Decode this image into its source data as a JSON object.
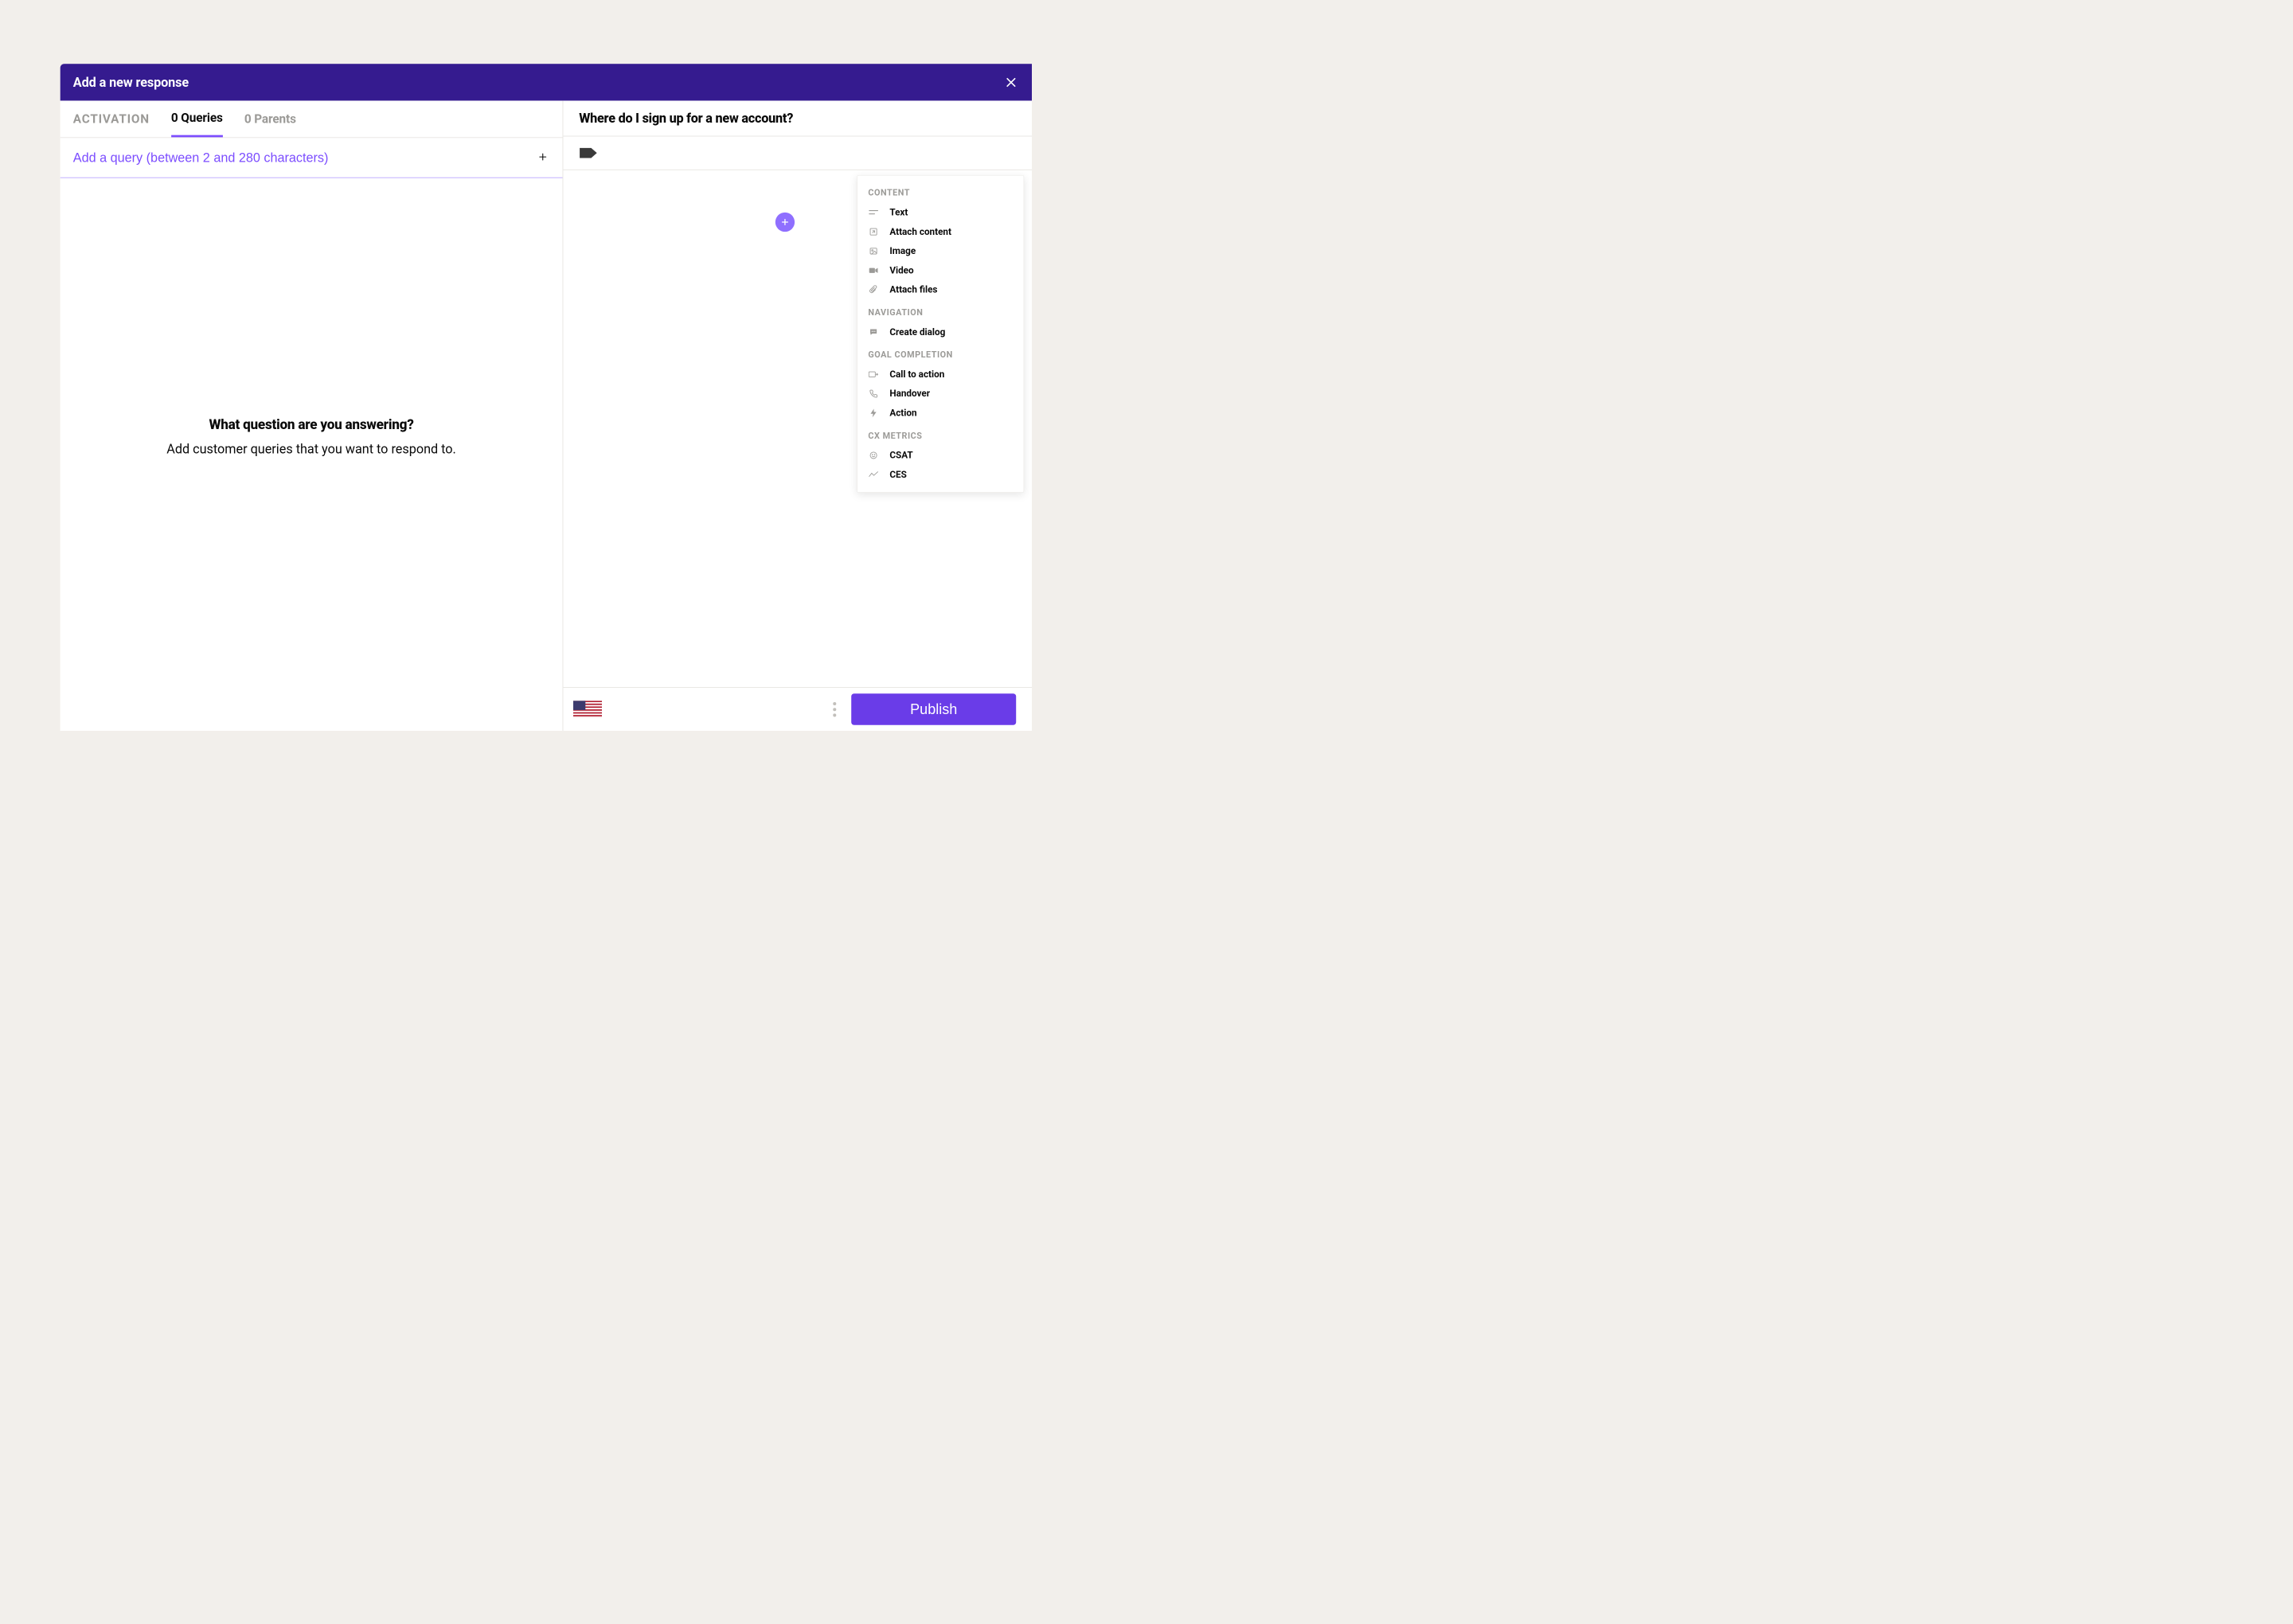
{
  "modal": {
    "title": "Add a new response"
  },
  "tabs": {
    "activation": "ACTIVATION",
    "queries": "0 Queries",
    "parents": "0 Parents"
  },
  "queryInput": {
    "placeholder": "Add a query (between 2 and 280 characters)"
  },
  "leftEmpty": {
    "heading": "What question are you answering?",
    "sub": "Add customer queries that you want to respond to."
  },
  "rightTitle": "Where do I sign up for a new account?",
  "popover": {
    "sections": {
      "content": {
        "title": "CONTENT",
        "items": {
          "text": "Text",
          "attach_content": "Attach content",
          "image": "Image",
          "video": "Video",
          "attach_files": "Attach files"
        }
      },
      "navigation": {
        "title": "NAVIGATION",
        "items": {
          "create_dialog": "Create dialog"
        }
      },
      "goal": {
        "title": "GOAL COMPLETION",
        "items": {
          "cta": "Call to action",
          "handover": "Handover",
          "action": "Action"
        }
      },
      "cx": {
        "title": "CX METRICS",
        "items": {
          "csat": "CSAT",
          "ces": "CES"
        }
      }
    }
  },
  "footer": {
    "publish": "Publish",
    "locale": "en-US"
  }
}
